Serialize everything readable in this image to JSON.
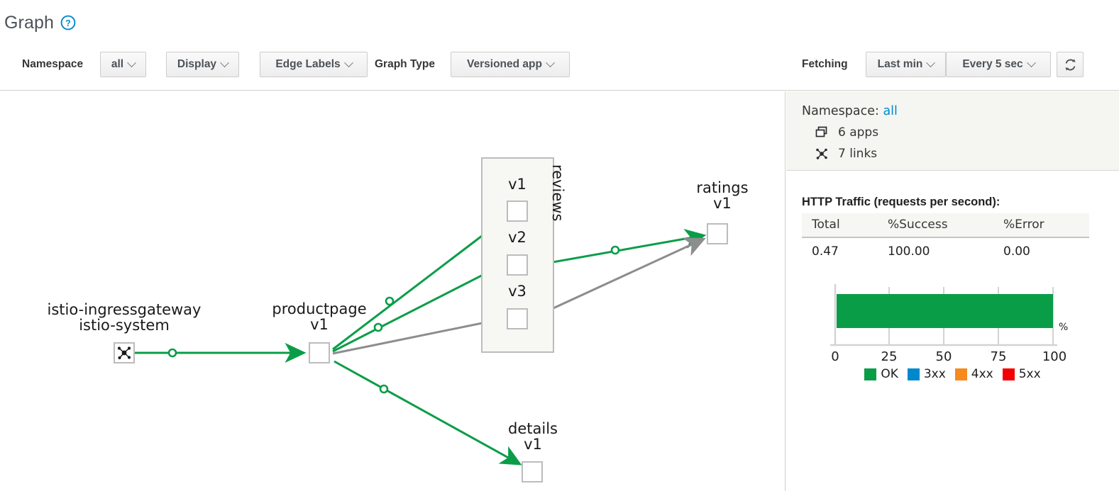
{
  "header": {
    "title": "Graph",
    "help_icon": "question-circle-icon"
  },
  "toolbar": {
    "namespace_label": "Namespace",
    "namespace_value": "all",
    "display_label": "Display",
    "edge_labels_label": "Edge Labels",
    "graph_type_label": "Graph Type",
    "graph_type_value": "Versioned app",
    "fetching_label": "Fetching",
    "duration_value": "Last min",
    "refresh_interval_value": "Every 5 sec",
    "refresh_icon": "refresh-icon"
  },
  "graph": {
    "nodes": [
      {
        "id": "ingressgateway",
        "name": "istio-ingressgateway",
        "sub": "istio-system",
        "icon": "mesh-gateway-icon"
      },
      {
        "id": "productpage",
        "name": "productpage",
        "sub": "v1"
      },
      {
        "id": "reviews-v1",
        "name": "v1",
        "sub": ""
      },
      {
        "id": "reviews-v2",
        "name": "v2",
        "sub": ""
      },
      {
        "id": "reviews-v3",
        "name": "v3",
        "sub": ""
      },
      {
        "id": "ratings",
        "name": "ratings",
        "sub": "v1"
      },
      {
        "id": "details",
        "name": "details",
        "sub": "v1"
      }
    ],
    "group_label": "reviews",
    "edges": [
      {
        "from": "ingressgateway",
        "to": "productpage",
        "status": "healthy"
      },
      {
        "from": "productpage",
        "to": "reviews-v1",
        "status": "healthy"
      },
      {
        "from": "productpage",
        "to": "reviews-v2",
        "status": "healthy"
      },
      {
        "from": "productpage",
        "to": "reviews-v3",
        "status": "idle"
      },
      {
        "from": "productpage",
        "to": "details",
        "status": "healthy"
      },
      {
        "from": "reviews-v2",
        "to": "ratings",
        "status": "healthy"
      },
      {
        "from": "reviews-v3",
        "to": "ratings",
        "status": "idle"
      }
    ]
  },
  "side_panel": {
    "namespace_prefix": "Namespace:",
    "namespace_value": "all",
    "apps_count": "6 apps",
    "links_count": "7 links",
    "apps_icon": "apps-stack-icon",
    "links_icon": "links-graph-icon",
    "traffic_title": "HTTP Traffic (requests per second):",
    "table": {
      "headers": [
        "Total",
        "%Success",
        "%Error"
      ],
      "rows": [
        [
          "0.47",
          "100.00",
          "0.00"
        ]
      ]
    }
  },
  "chart_data": {
    "type": "bar",
    "orientation": "horizontal",
    "categories": [
      "HTTP"
    ],
    "series": [
      {
        "name": "OK",
        "values": [
          100
        ],
        "color": "#0a9d48"
      },
      {
        "name": "3xx",
        "values": [
          0
        ],
        "color": "#0088ce"
      },
      {
        "name": "4xx",
        "values": [
          0
        ],
        "color": "#f68a1e"
      },
      {
        "name": "5xx",
        "values": [
          0
        ],
        "color": "#f50000"
      }
    ],
    "title": "",
    "xlabel": "%",
    "ylabel": "",
    "xlim": [
      0,
      100
    ],
    "xticks": [
      0,
      25,
      50,
      75,
      100
    ],
    "xticklabels": [
      "0",
      "25",
      "50",
      "75",
      "100"
    ],
    "axis_unit_label": "%",
    "grid": false,
    "legend_position": "bottom",
    "legend": [
      "OK",
      "3xx",
      "4xx",
      "5xx"
    ]
  },
  "colors": {
    "healthy_edge": "#0a9d48",
    "idle_edge": "#8b8d8f",
    "node_border": "#bcbcbc",
    "link_blue": "#0088ce"
  }
}
